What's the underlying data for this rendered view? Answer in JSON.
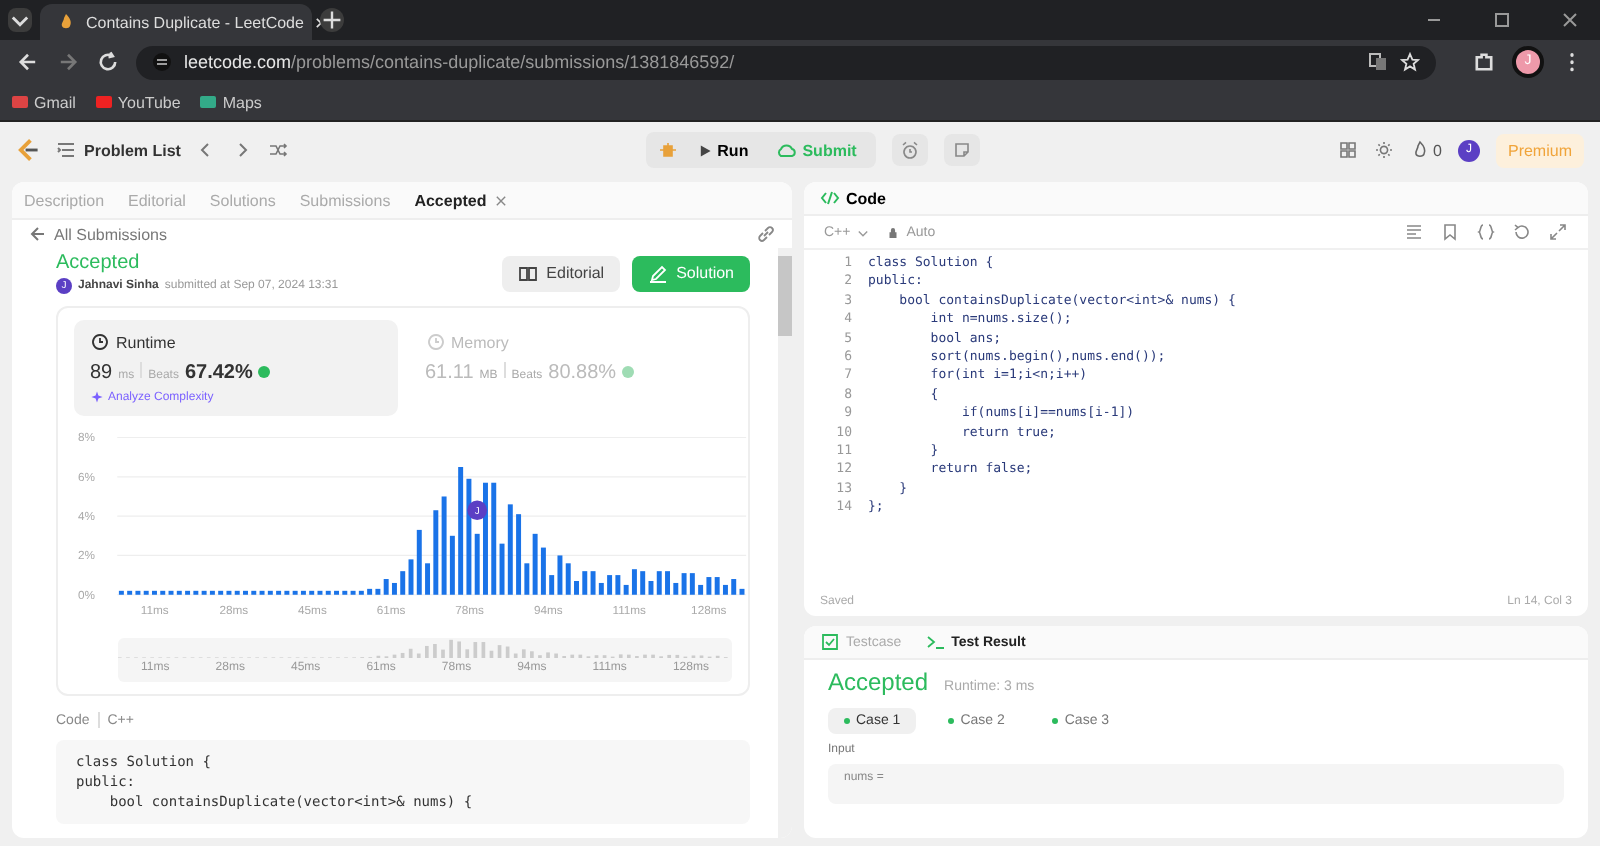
{
  "browser": {
    "tab_title": "Contains Duplicate - LeetCode",
    "url_domain": "leetcode.com",
    "url_path": "/problems/contains-duplicate/submissions/1381846592/",
    "bookmarks": [
      "Gmail",
      "YouTube",
      "Maps"
    ],
    "profile": "J"
  },
  "header": {
    "problem_list": "Problem List",
    "run": "Run",
    "submit": "Submit",
    "streak": "0",
    "avatar": "J",
    "premium": "Premium"
  },
  "left_tabs": [
    {
      "label": "Description",
      "selected": false,
      "closable": false
    },
    {
      "label": "Editorial",
      "selected": false,
      "closable": false
    },
    {
      "label": "Solutions",
      "selected": false,
      "closable": false
    },
    {
      "label": "Submissions",
      "selected": false,
      "closable": false
    },
    {
      "label": "Accepted",
      "selected": true,
      "closable": true
    }
  ],
  "back_link": "All Submissions",
  "submission": {
    "status": "Accepted",
    "author": "Jahnavi Sinha",
    "avatar": "J",
    "submitted": "submitted at Sep 07, 2024 13:31",
    "editorial_button": "Editorial",
    "solution_button": "Solution"
  },
  "metrics": [
    {
      "label": "Runtime",
      "value": "89",
      "unit": "ms",
      "beats_label": "Beats",
      "beats": "67.42%",
      "selected": true
    },
    {
      "label": "Memory",
      "value": "61.11",
      "unit": "MB",
      "beats_label": "Beats",
      "beats": "80.88%",
      "selected": false
    }
  ],
  "analyze": "Analyze Complexity",
  "chart_data": {
    "type": "bar",
    "grid": true,
    "ylim": [
      0,
      8
    ],
    "yticks": [
      {
        "value": 0,
        "label": "0%"
      },
      {
        "value": 2,
        "label": "2%"
      },
      {
        "value": 4,
        "label": "4%"
      },
      {
        "value": 6,
        "label": "6%"
      },
      {
        "value": 8,
        "label": "8%"
      }
    ],
    "values": [
      0.2,
      0.2,
      0.2,
      0.2,
      0.2,
      0.2,
      0.2,
      0.2,
      0.2,
      0.2,
      0.2,
      0.2,
      0.2,
      0.2,
      0.2,
      0.2,
      0.2,
      0.2,
      0.2,
      0.2,
      0.2,
      0.2,
      0.2,
      0.2,
      0.2,
      0.2,
      0.2,
      0.2,
      0.2,
      0.2,
      0.3,
      0.3,
      0.8,
      0.6,
      1.2,
      1.8,
      3.3,
      1.6,
      4.3,
      5.0,
      3.0,
      6.5,
      5.9,
      3.1,
      5.7,
      5.7,
      2.6,
      4.6,
      4.1,
      1.6,
      3.1,
      2.4,
      1.0,
      2.0,
      1.6,
      0.7,
      1.2,
      1.2,
      0.6,
      1.0,
      1.0,
      0.5,
      1.3,
      1.2,
      0.7,
      1.2,
      1.2,
      0.6,
      1.1,
      1.1,
      0.5,
      0.9,
      0.9,
      0.5,
      0.8,
      0.3
    ]
  },
  "chart_axis_labels": [
    "11ms",
    "28ms",
    "45ms",
    "61ms",
    "78ms",
    "94ms",
    "111ms",
    "128ms"
  ],
  "chart_marker": "J",
  "range_labels": [
    "11ms",
    "28ms",
    "45ms",
    "61ms",
    "78ms",
    "94ms",
    "111ms",
    "128ms"
  ],
  "code_section": {
    "label": "Code",
    "language": "C++",
    "lines": [
      "class Solution {",
      "public:",
      "    bool containsDuplicate(vector<int>& nums) {"
    ]
  },
  "editor": {
    "title": "Code",
    "language": "C++",
    "mode": "Auto",
    "status": "Saved",
    "cursor": "Ln 14, Col 3",
    "lines": [
      {
        "num": "1",
        "text": "class Solution {"
      },
      {
        "num": "2",
        "text": "public:"
      },
      {
        "num": "3",
        "text": "    bool containsDuplicate(vector<int>& nums) {"
      },
      {
        "num": "4",
        "text": "        int n=nums.size();"
      },
      {
        "num": "5",
        "text": "        bool ans;"
      },
      {
        "num": "6",
        "text": "        sort(nums.begin(),nums.end());"
      },
      {
        "num": "7",
        "text": "        for(int i=1;i<n;i++)"
      },
      {
        "num": "8",
        "text": "        {"
      },
      {
        "num": "9",
        "text": "            if(nums[i]==nums[i-1])"
      },
      {
        "num": "10",
        "text": "            return true;"
      },
      {
        "num": "11",
        "text": "        }"
      },
      {
        "num": "12",
        "text": "        return false;"
      },
      {
        "num": "13",
        "text": "    }"
      },
      {
        "num": "14",
        "text": "};"
      }
    ]
  },
  "results": {
    "tabs": [
      {
        "label": "Testcase",
        "selected": false
      },
      {
        "label": "Test Result",
        "selected": true
      }
    ],
    "status": "Accepted",
    "runtime": "Runtime: 3 ms",
    "cases": [
      {
        "label": "Case 1",
        "selected": true
      },
      {
        "label": "Case 2",
        "selected": false
      },
      {
        "label": "Case 3",
        "selected": false
      }
    ],
    "input_label": "Input",
    "param": "nums ="
  }
}
